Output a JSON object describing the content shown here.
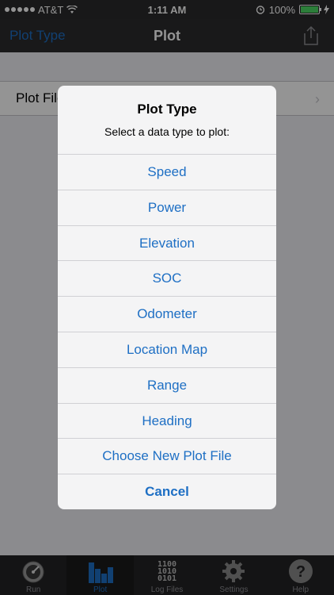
{
  "status_bar": {
    "carrier": "AT&T",
    "time": "1:11 AM",
    "battery_percent": "100%",
    "battery_level": 1.0
  },
  "nav": {
    "back_label": "Plot Type",
    "title": "Plot"
  },
  "content": {
    "cell_label": "Plot File"
  },
  "alert": {
    "title": "Plot Type",
    "message": "Select a data type to plot:",
    "options": [
      "Speed",
      "Power",
      "Elevation",
      "SOC",
      "Odometer",
      "Location Map",
      "Range",
      "Heading",
      "Choose New Plot File"
    ],
    "cancel_label": "Cancel"
  },
  "tabs": [
    {
      "label": "Run",
      "icon": "gauge-icon"
    },
    {
      "label": "Plot",
      "icon": "bar-chart-icon"
    },
    {
      "label": "Log Files",
      "icon": "binary-icon",
      "glyph": "1100\n1010\n0101"
    },
    {
      "label": "Settings",
      "icon": "gear-icon"
    },
    {
      "label": "Help",
      "icon": "help-icon",
      "glyph": "?"
    }
  ],
  "colors": {
    "accent": "#1e6fc4",
    "tab_inactive": "#8e8e93"
  }
}
